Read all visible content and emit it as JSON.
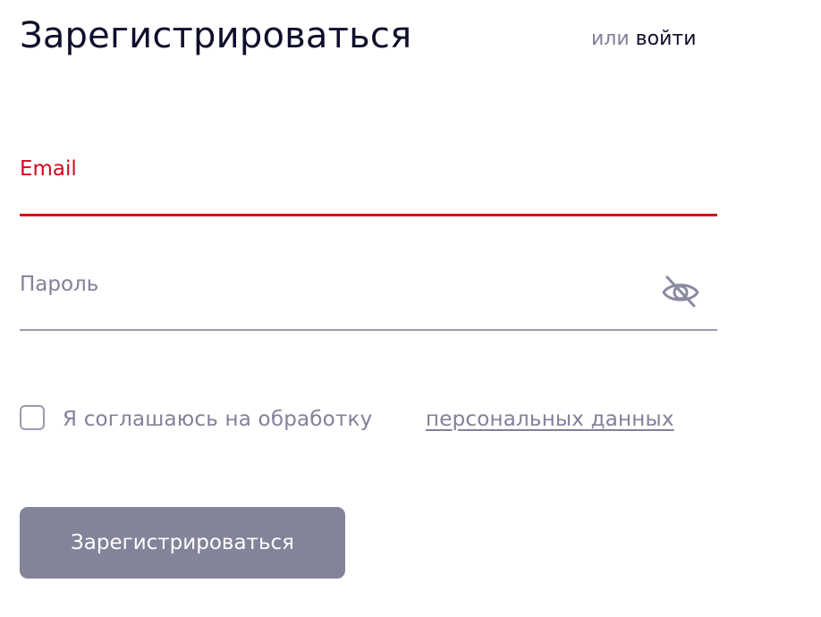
{
  "header": {
    "title": "Зарегистрироваться",
    "or_text": "или",
    "login_link": "войти"
  },
  "form": {
    "email": {
      "label": "Email",
      "value": "",
      "state_color": "#d6061c"
    },
    "password": {
      "label": "Пароль",
      "value": "",
      "toggle_icon": "eye-off-icon"
    },
    "consent": {
      "checked": false,
      "text": "Я соглашаюсь на обработку",
      "link_text": "персональных данных"
    },
    "submit_label": "Зарегистрироваться"
  },
  "colors": {
    "title": "#0e0e2c",
    "muted": "#81819a",
    "error": "#d6061c",
    "button_bg": "#838399"
  }
}
